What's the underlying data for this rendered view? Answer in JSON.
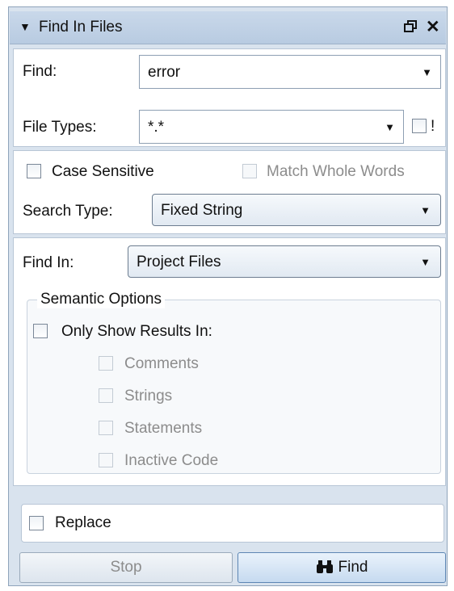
{
  "panel": {
    "title": "Find In Files",
    "collapse_icon": "triangle-down",
    "float_icon": "window-restore",
    "close_icon": "x"
  },
  "find": {
    "label": "Find:",
    "value": "error"
  },
  "file_types": {
    "label": "File Types:",
    "value": "*.*",
    "exclude_label": "!",
    "exclude_checked": false
  },
  "options": {
    "case_sensitive": {
      "label": "Case Sensitive",
      "checked": false
    },
    "match_whole_words": {
      "label": "Match Whole Words",
      "checked": false,
      "enabled": false
    },
    "search_type_label": "Search Type:",
    "search_type_value": "Fixed String"
  },
  "find_in": {
    "label": "Find In:",
    "value": "Project Files"
  },
  "semantic": {
    "title": "Semantic Options",
    "only_show": {
      "label": "Only Show Results In:",
      "checked": false
    },
    "items": [
      {
        "label": "Comments",
        "checked": false
      },
      {
        "label": "Strings",
        "checked": false
      },
      {
        "label": "Statements",
        "checked": false
      },
      {
        "label": "Inactive Code",
        "checked": false
      }
    ]
  },
  "replace": {
    "label": "Replace",
    "checked": false
  },
  "buttons": {
    "stop": "Stop",
    "find": "Find",
    "find_icon": "binoculars"
  }
}
